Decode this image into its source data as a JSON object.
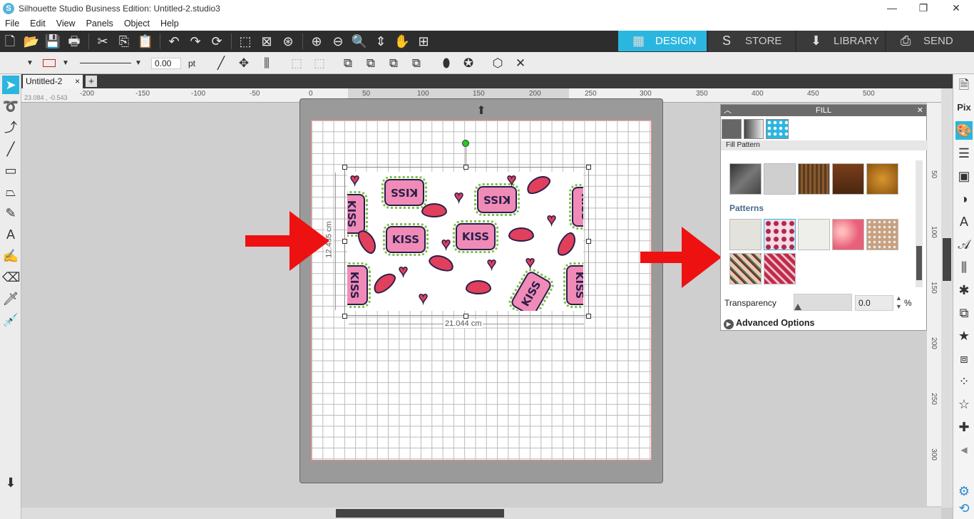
{
  "window": {
    "title": "Silhouette Studio Business Edition: Untitled-2.studio3",
    "app_initial": "S"
  },
  "menu": [
    "File",
    "Edit",
    "View",
    "Panels",
    "Object",
    "Help"
  ],
  "nav_tabs": [
    {
      "label": "DESIGN",
      "icon": "grid-icon",
      "active": true
    },
    {
      "label": "STORE",
      "icon": "store-icon",
      "active": false
    },
    {
      "label": "LIBRARY",
      "icon": "library-icon",
      "active": false
    },
    {
      "label": "SEND",
      "icon": "send-icon",
      "active": false
    }
  ],
  "line_settings": {
    "width_value": "0.00",
    "unit": "pt"
  },
  "doc_tab": {
    "name": "Untitled-2",
    "close": "×",
    "add": "+"
  },
  "ruler": {
    "coords": "23.084 , -0.543",
    "h_ticks": [
      "-200",
      "-150",
      "-100",
      "-50",
      "0",
      "50",
      "100",
      "150",
      "200",
      "250",
      "300",
      "350",
      "400",
      "450",
      "500"
    ],
    "v_ticks": [
      "50",
      "100",
      "150",
      "200",
      "250",
      "300"
    ]
  },
  "selection": {
    "width_label": "21.044 cm",
    "height_label": "12.435 cm"
  },
  "design": {
    "text": "KISS"
  },
  "fill_panel": {
    "title": "FILL",
    "subheader": "Fill Pattern",
    "section": "Patterns",
    "transparency_label": "Transparency",
    "transparency_value": "0.0",
    "transparency_unit": "%",
    "advanced": "Advanced Options"
  },
  "colors": {
    "accent": "#2bb6e0",
    "arrow": "#ee1111",
    "lip": "#e0405c",
    "kiss_bg": "#f08bb8"
  }
}
